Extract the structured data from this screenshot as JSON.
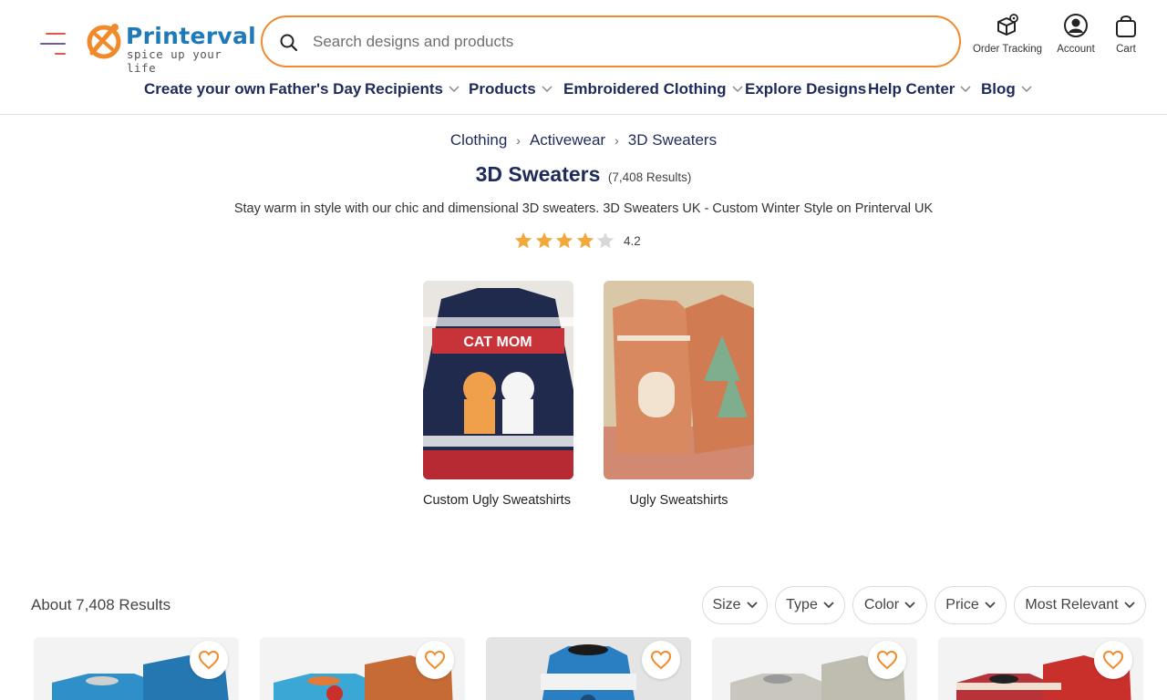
{
  "brand": {
    "name": "Printerval",
    "tagline": "spice up your life",
    "colors": {
      "primary": "#1f7ab8",
      "accent": "#f08a2a",
      "nav_text": "#1e2a5a"
    }
  },
  "search": {
    "placeholder": "Search designs and products",
    "value": ""
  },
  "header_icons": {
    "tracking": {
      "label": "Order Tracking",
      "icon": "package-location-icon"
    },
    "account": {
      "label": "Account",
      "icon": "user-circle-icon"
    },
    "cart": {
      "label": "Cart",
      "icon": "shopping-bag-icon"
    }
  },
  "nav": [
    {
      "label": "Create your own",
      "dropdown": false
    },
    {
      "label": "Father's Day",
      "dropdown": false
    },
    {
      "label": "Recipients",
      "dropdown": true
    },
    {
      "label": "Products",
      "dropdown": true
    },
    {
      "label": "Embroidered Clothing",
      "dropdown": true
    },
    {
      "label": "Explore Designs",
      "dropdown": false
    },
    {
      "label": "Help Center",
      "dropdown": true
    },
    {
      "label": "Blog",
      "dropdown": true
    }
  ],
  "breadcrumb": [
    "Clothing",
    "Activewear",
    "3D Sweaters"
  ],
  "page": {
    "title": "3D Sweaters",
    "count": "(7,408 Results)",
    "description": "Stay warm in style with our chic and dimensional 3D sweaters. 3D Sweaters UK - Custom Winter Style on Printerval UK",
    "rating": 4.2,
    "rating_label": "4.2"
  },
  "categories": [
    {
      "label": "Custom Ugly Sweatshirts"
    },
    {
      "label": "Ugly Sweatshirts"
    }
  ],
  "results_label": "About 7,408 Results",
  "filters": [
    {
      "label": "Size"
    },
    {
      "label": "Type"
    },
    {
      "label": "Color"
    },
    {
      "label": "Price"
    },
    {
      "label": "Most Relevant"
    }
  ]
}
